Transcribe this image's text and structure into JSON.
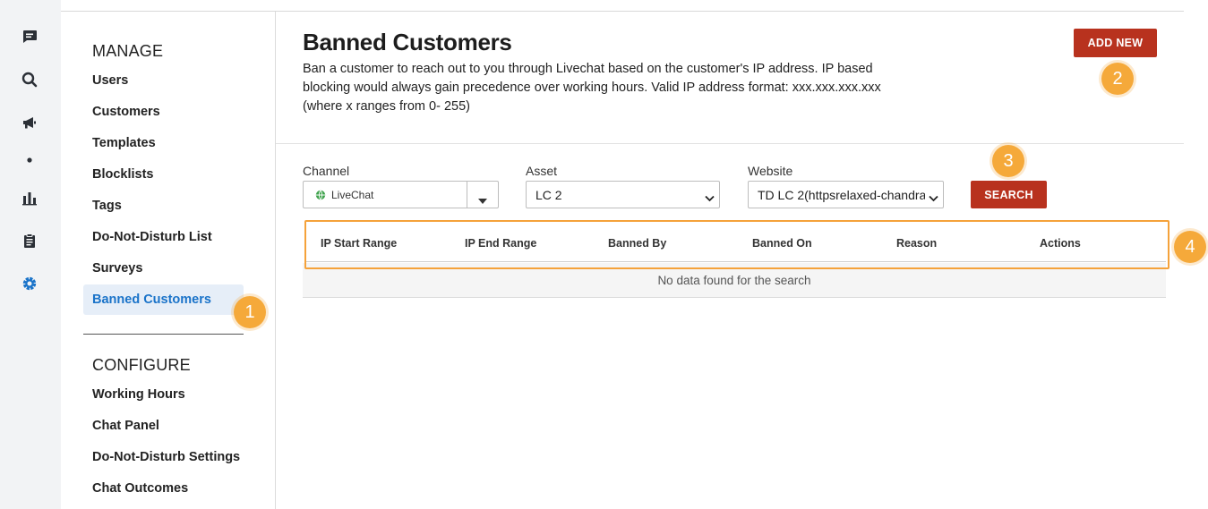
{
  "rail": {
    "icons": [
      "chat-icon",
      "search-icon",
      "megaphone-icon",
      "dot-icon",
      "bar-chart-icon",
      "clipboard-icon",
      "gear-icon"
    ],
    "active_color": "#1a73c9"
  },
  "nav": {
    "manage_title": "MANAGE",
    "manage_items": [
      "Users",
      "Customers",
      "Templates",
      "Blocklists",
      "Tags",
      "Do-Not-Disturb List",
      "Surveys",
      "Banned Customers"
    ],
    "configure_title": "CONFIGURE",
    "configure_items": [
      "Working Hours",
      "Chat Panel",
      "Do-Not-Disturb Settings",
      "Chat Outcomes"
    ]
  },
  "header": {
    "title": "Banned Customers",
    "description": "Ban a customer to reach out to you through Livechat based on the customer's IP address. IP based blocking would always gain precedence over working hours. Valid IP address format: xxx.xxx.xxx.xxx (where x ranges from 0- 255)",
    "add_new_label": "ADD NEW"
  },
  "filters": {
    "channel_label": "Channel",
    "channel_value": "LiveChat",
    "asset_label": "Asset",
    "asset_value": "LC 2",
    "website_label": "Website",
    "website_value": "TD LC 2(httpsrelaxed-chandra",
    "search_label": "SEARCH"
  },
  "table": {
    "columns": [
      "IP Start Range",
      "IP End Range",
      "Banned By",
      "Banned On",
      "Reason",
      "Actions"
    ],
    "empty_text": "No data found for the search"
  },
  "callouts": [
    "1",
    "2",
    "3",
    "4"
  ],
  "colors": {
    "accent_button": "#b8321e",
    "callout": "#f5a93a",
    "highlight_border": "#f5a23a",
    "active_nav_bg": "#e6eef8",
    "active_nav_text": "#1a73c9"
  }
}
